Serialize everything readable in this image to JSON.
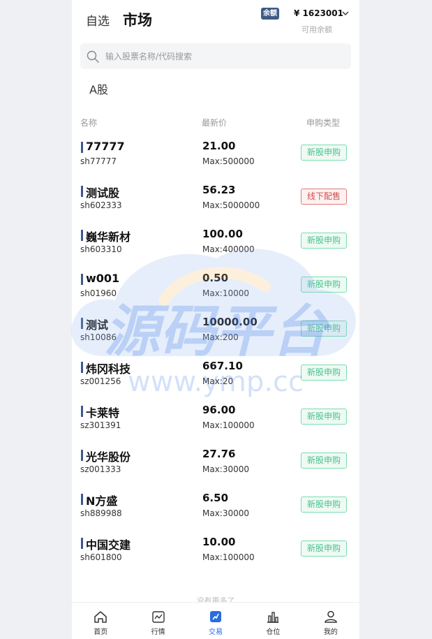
{
  "header": {
    "tab_watchlist": "自选",
    "tab_market": "市场",
    "balance_badge": "余额",
    "balance_amount": "¥ 1623001",
    "balance_label": "可用余额"
  },
  "search": {
    "placeholder": "输入股票名称/代码搜索"
  },
  "section_title": "A股",
  "columns": {
    "name": "名称",
    "price": "最新价",
    "type": "申购类型"
  },
  "stocks": [
    {
      "name": "77777",
      "code": "sh77777",
      "price": "21.00",
      "max": "Max:500000",
      "type": "新股申购",
      "offline": false
    },
    {
      "name": "测试股",
      "code": "sh602333",
      "price": "56.23",
      "max": "Max:5000000",
      "type": "线下配售",
      "offline": true
    },
    {
      "name": "巍华新材",
      "code": "sh603310",
      "price": "100.00",
      "max": "Max:400000",
      "type": "新股申购",
      "offline": false
    },
    {
      "name": "w001",
      "code": "sh01960",
      "price": "0.50",
      "max": "Max:10000",
      "type": "新股申购",
      "offline": false
    },
    {
      "name": "测试",
      "code": "sh10086",
      "price": "10000.00",
      "max": "Max:200",
      "type": "新股申购",
      "offline": false
    },
    {
      "name": "炜冈科技",
      "code": "sz001256",
      "price": "667.10",
      "max": "Max:20",
      "type": "新股申购",
      "offline": false
    },
    {
      "name": "卡莱特",
      "code": "sz301391",
      "price": "96.00",
      "max": "Max:100000",
      "type": "新股申购",
      "offline": false
    },
    {
      "name": "光华股份",
      "code": "sz001333",
      "price": "27.76",
      "max": "Max:30000",
      "type": "新股申购",
      "offline": false
    },
    {
      "name": "N方盛",
      "code": "sh889988",
      "price": "6.50",
      "max": "Max:30000",
      "type": "新股申购",
      "offline": false
    },
    {
      "name": "中国交建",
      "code": "sh601800",
      "price": "10.00",
      "max": "Max:100000",
      "type": "新股申购",
      "offline": false
    }
  ],
  "footer_text": "没有更多了",
  "tabbar": [
    {
      "label": "首页",
      "icon": "home-icon",
      "active": false
    },
    {
      "label": "行情",
      "icon": "chart-icon",
      "active": false
    },
    {
      "label": "交易",
      "icon": "trade-icon",
      "active": true
    },
    {
      "label": "仓位",
      "icon": "position-icon",
      "active": false
    },
    {
      "label": "我的",
      "icon": "user-icon",
      "active": false
    }
  ],
  "watermark": {
    "title": "源码平台",
    "url": "www.ymp.cc"
  },
  "colors": {
    "accent": "#2a6be0",
    "badge": "#3e5b86",
    "tag_green": "#4cc08e",
    "tag_red": "#d44c4c"
  }
}
